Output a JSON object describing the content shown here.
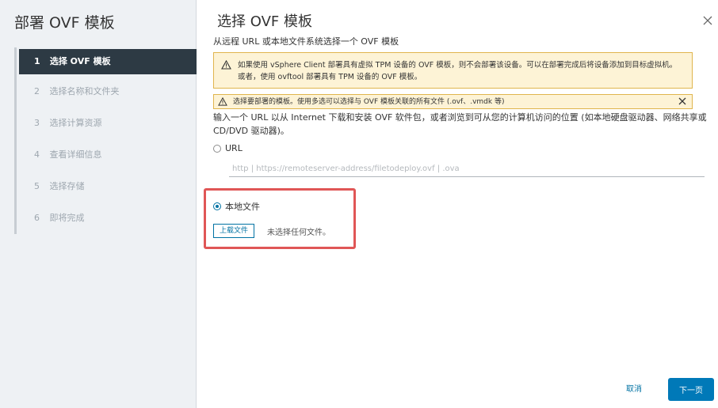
{
  "wizard": {
    "title": "部署 OVF 模板",
    "steps": [
      {
        "num": "1",
        "label": "选择 OVF 模板",
        "active": true
      },
      {
        "num": "2",
        "label": "选择名称和文件夹",
        "active": false
      },
      {
        "num": "3",
        "label": "选择计算资源",
        "active": false
      },
      {
        "num": "4",
        "label": "查看详细信息",
        "active": false
      },
      {
        "num": "5",
        "label": "选择存储",
        "active": false
      },
      {
        "num": "6",
        "label": "即将完成",
        "active": false
      }
    ]
  },
  "page": {
    "title": "选择 OVF 模板",
    "subtitle": "从远程 URL 或本地文件系统选择一个 OVF 模板",
    "close_icon": "close-icon"
  },
  "alerts": {
    "tpm_warning": "如果使用 vSphere Client 部署具有虚拟 TPM 设备的 OVF 模板，则不会部署该设备。可以在部署完成后将设备添加到目标虚拟机。或者，使用 ovftool 部署具有 TPM 设备的 OVF 模板。",
    "select_files": "选择要部署的模板。使用多选可以选择与 OVF 模板关联的所有文件 (.ovf、.vmdk 等)"
  },
  "description": "输入一个 URL 以从 Internet 下载和安装 OVF 软件包，或者浏览到可从您的计算机访问的位置 (如本地硬盘驱动器、网络共享或 CD/DVD 驱动器)。",
  "source": {
    "url_option_label": "URL",
    "url_placeholder": "http | https://remoteserver-address/filetodeploy.ovf | .ova",
    "local_option_label": "本地文件",
    "selected": "local",
    "upload_button": "上载文件",
    "no_file_text": "未选择任何文件。"
  },
  "footer": {
    "cancel": "取消",
    "next": "下一页"
  },
  "colors": {
    "sidebar_bg": "#eef1f4",
    "active_step_bg": "#2d3a44",
    "primary": "#0079b8",
    "warning_bg": "#fdf3d6",
    "highlight": "#e05656"
  }
}
